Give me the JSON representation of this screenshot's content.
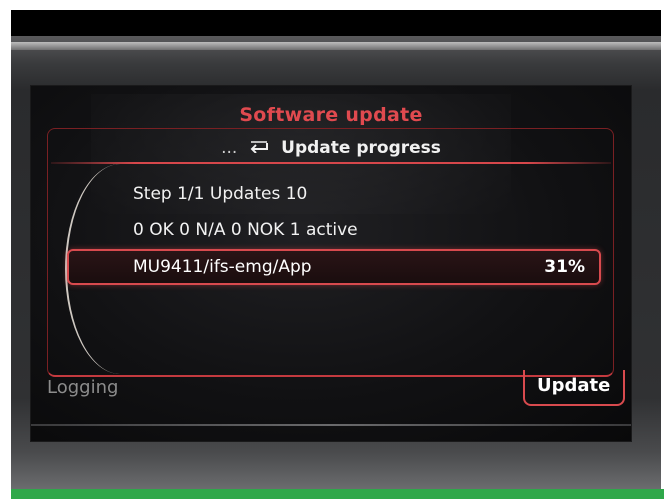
{
  "screen": {
    "title": "Software update",
    "breadcrumb": {
      "dots": "...",
      "back_icon": "back-arrow-icon",
      "label": "Update progress"
    },
    "step_line": "Step 1/1 Updates 10",
    "status_line": "0 OK 0 N/A 0 NOK 1 active",
    "active_item": {
      "name": "MU9411/ifs-emg/App",
      "progress": "31%"
    },
    "softkeys": {
      "left": "Logging",
      "right": "Update"
    }
  },
  "colors": {
    "accent": "#d84a4e",
    "title": "#e04a4f",
    "text": "#f2f2f2",
    "muted": "#8c8c8c",
    "screen_bg": "#111113"
  }
}
